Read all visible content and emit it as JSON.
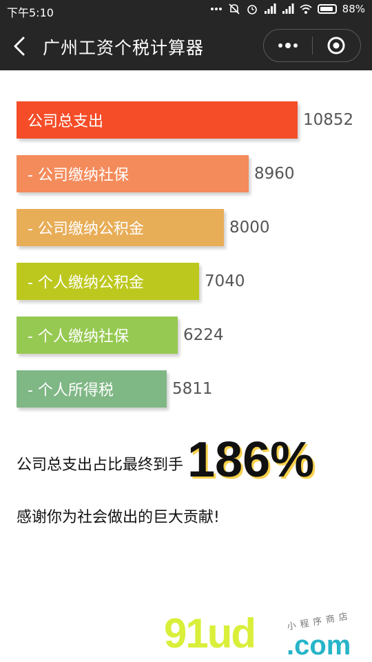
{
  "status_bar": {
    "time": "下午5:10",
    "battery": "88%",
    "icons": [
      "more-dots-icon",
      "mute-bell-icon",
      "alarm-icon",
      "signal-icon",
      "signal-icon",
      "wifi-icon",
      "battery-icon"
    ]
  },
  "nav": {
    "title": "广州工资个税计算器",
    "back_icon": "back-arrow-icon",
    "menu_icon": "more-dots-icon",
    "close_icon": "target-circle-icon"
  },
  "chart_data": {
    "type": "bar",
    "categories": [
      "公司总支出",
      "- 公司缴纳社保",
      "- 公司缴纳公积金",
      "- 个人缴纳公积金",
      "- 个人缴纳社保",
      "- 个人所得税"
    ],
    "values": [
      10852,
      8960,
      8000,
      7040,
      6224,
      5811
    ],
    "colors": [
      "#f44d28",
      "#f48b5b",
      "#e8ad57",
      "#bdc81f",
      "#96c951",
      "#7fb785"
    ],
    "orientation": "horizontal"
  },
  "summary": {
    "label": "公司总支出占比最终到手",
    "percent": "186%"
  },
  "thanks": "感谢你为社会做出的巨大贡献!",
  "watermark": {
    "brand": "91ud",
    "domain": ".com",
    "tagline": "小程序商店"
  }
}
